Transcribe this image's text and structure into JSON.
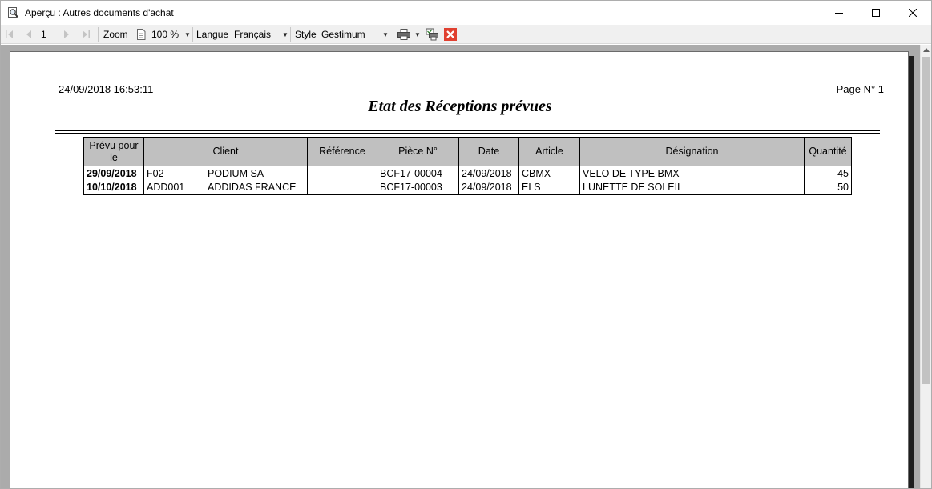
{
  "window": {
    "title": "Aperçu : Autres documents d'achat",
    "icon": "magnifier-document-icon"
  },
  "toolbar": {
    "page_number": "1",
    "zoom_label": "Zoom",
    "zoom_value": "100 %",
    "language_label": "Langue",
    "language_value": "Français",
    "style_label": "Style",
    "style_value": "Gestimum"
  },
  "report": {
    "datetime": "24/09/2018 16:53:11",
    "page_label": "Page N° 1",
    "title": "Etat des Réceptions prévues",
    "columns": [
      "Prévu pour le",
      "Client",
      "Référence",
      "Pièce N°",
      "Date",
      "Article",
      "Désignation",
      "Quantité"
    ],
    "rows": [
      {
        "prevu": "29/09/2018",
        "client_code": "F02",
        "client_name": "PODIUM SA",
        "reference": "",
        "piece": "BCF17-00004",
        "date": "24/09/2018",
        "article": "CBMX",
        "designation": "VELO DE TYPE BMX",
        "quantite": "45"
      },
      {
        "prevu": "10/10/2018",
        "client_code": "ADD001",
        "client_name": "ADDIDAS FRANCE",
        "reference": "",
        "piece": "BCF17-00003",
        "date": "24/09/2018",
        "article": "ELS",
        "designation": "LUNETTE DE SOLEIL",
        "quantite": "50"
      }
    ]
  },
  "colors": {
    "header_fill": "#c0c0c0",
    "preview_background": "#ababab",
    "close_report_red": "#e04030"
  }
}
